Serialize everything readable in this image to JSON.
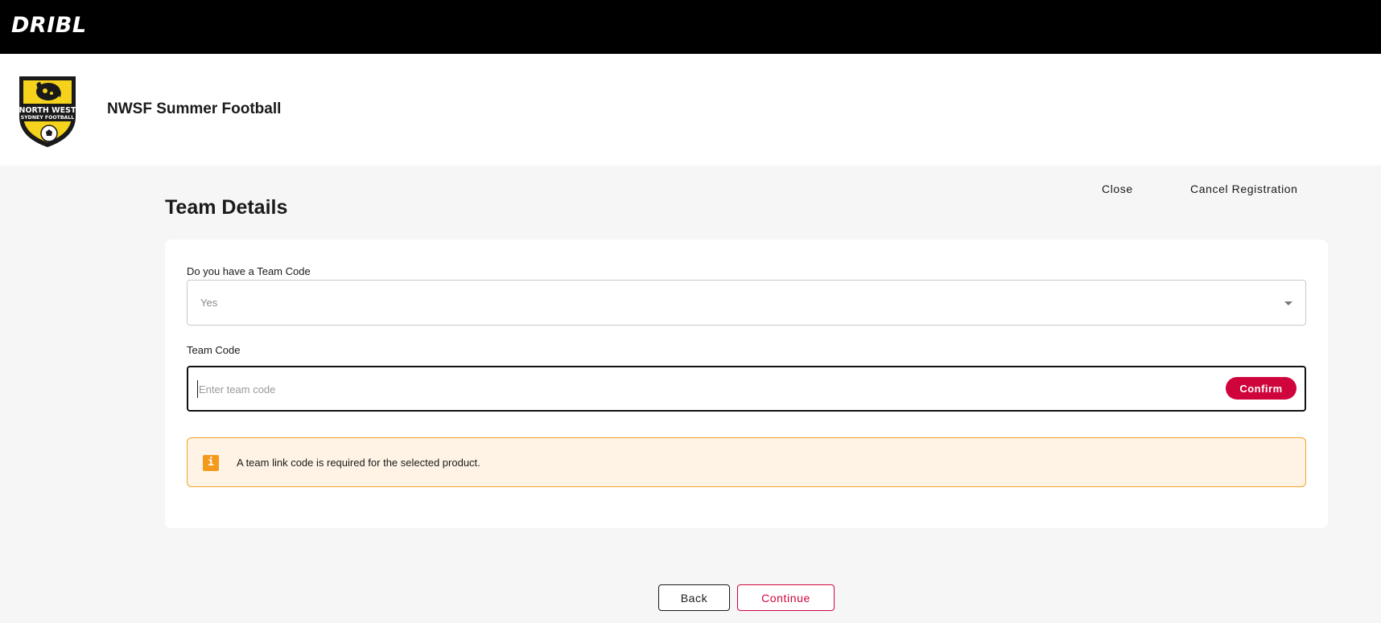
{
  "brand": {
    "name": "DRIBL"
  },
  "organisation": {
    "name": "NWSF Summer Football",
    "logo": {
      "icon": "club-crest-logo",
      "text_line1": "NORTH WEST",
      "text_line2": "SYDNEY FOOTBALL"
    }
  },
  "page": {
    "title": "Team Details",
    "close_label": "Close",
    "cancel_label": "Cancel Registration"
  },
  "form": {
    "team_code_question": {
      "label": "Do you have a Team Code",
      "selected_value": "Yes",
      "icon": "chevron-down-icon"
    },
    "team_code": {
      "label": "Team Code",
      "value": "",
      "placeholder": "Enter team code",
      "confirm_label": "Confirm"
    },
    "alert": {
      "icon_glyph": "i",
      "icon": "info-icon",
      "message": "A team link code is required for the selected product."
    }
  },
  "footer": {
    "back_label": "Back",
    "continue_label": "Continue"
  },
  "colors": {
    "topbar": "#000000",
    "accent": "#d0043c",
    "alert_background": "#fef3e4",
    "alert_border": "#f3a52c",
    "alert_icon": "#f39a1d",
    "page_background": "#f6f6f6",
    "logo_yellow": "#f5d21c"
  }
}
